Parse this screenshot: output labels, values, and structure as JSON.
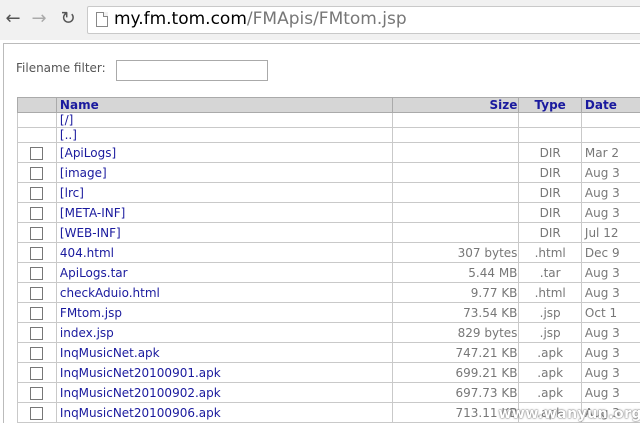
{
  "browser": {
    "url_domain": "my.fm.tom.com",
    "url_path": "/FMApis/FMtom.jsp"
  },
  "filter": {
    "label": "Filename filter:",
    "value": ""
  },
  "table": {
    "headers": {
      "name": "Name",
      "size": "Size",
      "type": "Type",
      "date": "Date"
    },
    "nav_rows": [
      "[/]",
      "[..]"
    ],
    "rows": [
      {
        "name": "[ApiLogs]",
        "size": "",
        "type": "DIR",
        "date": "Mar 2"
      },
      {
        "name": "[image]",
        "size": "",
        "type": "DIR",
        "date": "Aug 3"
      },
      {
        "name": "[lrc]",
        "size": "",
        "type": "DIR",
        "date": "Aug 3"
      },
      {
        "name": "[META-INF]",
        "size": "",
        "type": "DIR",
        "date": "Aug 3"
      },
      {
        "name": "[WEB-INF]",
        "size": "",
        "type": "DIR",
        "date": "Jul 12"
      },
      {
        "name": "404.html",
        "size": "307 bytes",
        "type": ".html",
        "date": "Dec 9"
      },
      {
        "name": "ApiLogs.tar",
        "size": "5.44 MB",
        "type": ".tar",
        "date": "Aug 3"
      },
      {
        "name": "checkAduio.html",
        "size": "9.77 KB",
        "type": ".html",
        "date": "Aug 3"
      },
      {
        "name": "FMtom.jsp",
        "size": "73.54 KB",
        "type": ".jsp",
        "date": "Oct 1"
      },
      {
        "name": "index.jsp",
        "size": "829 bytes",
        "type": ".jsp",
        "date": "Aug 3"
      },
      {
        "name": "InqMusicNet.apk",
        "size": "747.21 KB",
        "type": ".apk",
        "date": "Aug 3"
      },
      {
        "name": "InqMusicNet20100901.apk",
        "size": "699.21 KB",
        "type": ".apk",
        "date": "Aug 3"
      },
      {
        "name": "InqMusicNet20100902.apk",
        "size": "697.73 KB",
        "type": ".apk",
        "date": "Aug 3"
      },
      {
        "name": "InqMusicNet20100906.apk",
        "size": "713.11 KB",
        "type": ".apk",
        "date": "Aug 3"
      }
    ]
  },
  "watermark": "www.wanyun.org"
}
